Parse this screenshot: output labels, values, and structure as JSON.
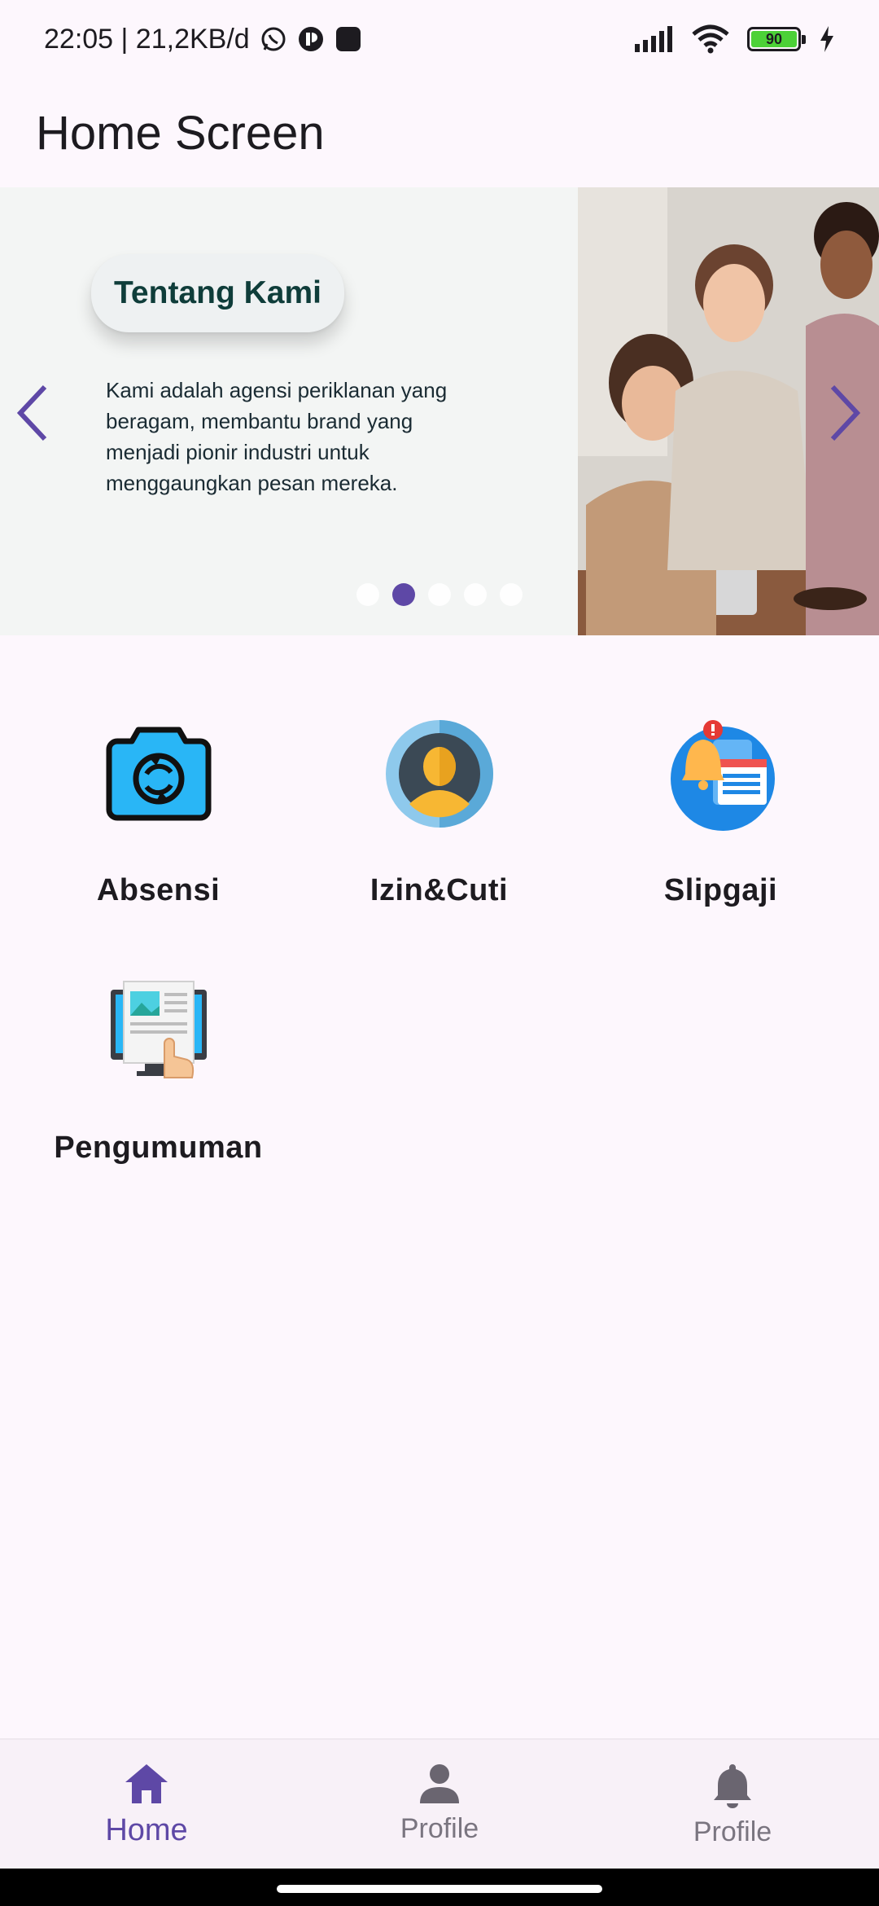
{
  "status_bar": {
    "time_speed": "22:05 | 21,2KB/d",
    "battery_level": "90"
  },
  "app_bar": {
    "title": "Home Screen"
  },
  "carousel": {
    "title": "Tentang Kami",
    "description": "Kami adalah agensi periklanan yang beragam, membantu brand yang menjadi pionir industri untuk menggaungkan pesan mereka.",
    "page_count": 5,
    "active_page": 2,
    "accent_color": "#5e48a6"
  },
  "menu": [
    {
      "label": "Absensi",
      "icon": "camera-sync-icon"
    },
    {
      "label": "Izin&Cuti",
      "icon": "user-avatar-icon"
    },
    {
      "label": "Slipgaji",
      "icon": "notification-document-icon"
    },
    {
      "label": "Pengumuman",
      "icon": "monitor-article-icon"
    }
  ],
  "bottom_nav": [
    {
      "label": "Home",
      "icon": "home-icon",
      "active": true
    },
    {
      "label": "Profile",
      "icon": "person-icon",
      "active": false
    },
    {
      "label": "Profile",
      "icon": "bell-icon",
      "active": false
    }
  ]
}
